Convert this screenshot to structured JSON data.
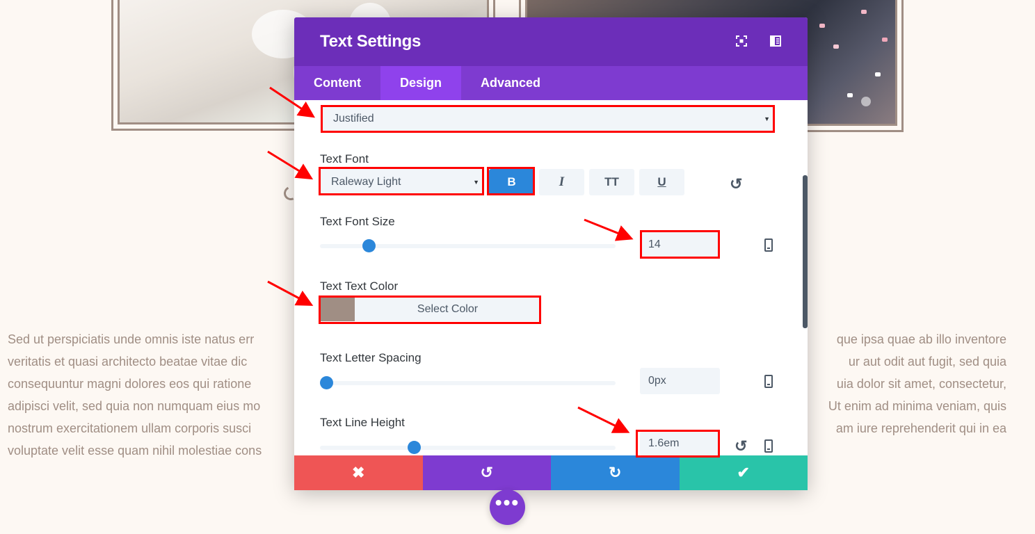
{
  "modal": {
    "title": "Text Settings",
    "header_icons": [
      "fullscreen-icon",
      "sidebar-layout-icon"
    ],
    "tabs": [
      {
        "label": "Content",
        "active": false
      },
      {
        "label": "Design",
        "active": true
      },
      {
        "label": "Advanced",
        "active": false
      }
    ]
  },
  "settings": {
    "text_orientation_value": "Justified",
    "text_font": {
      "label": "Text Font",
      "value": "Raleway Light",
      "bold": "B",
      "italic": "I",
      "uppercase": "TT",
      "underline": "U",
      "bold_active": true
    },
    "font_size": {
      "label": "Text Font Size",
      "value": "14",
      "slider_fraction": 0.15
    },
    "text_color": {
      "label": "Text Text Color",
      "swatch": "#a08e84",
      "button": "Select Color"
    },
    "letter_spacing": {
      "label": "Text Letter Spacing",
      "value": "0px",
      "slider_fraction": 0.0
    },
    "line_height": {
      "label": "Text Line Height",
      "value": "1.6em",
      "slider_fraction": 0.31
    }
  },
  "footer": {
    "icons": [
      "close-icon",
      "undo-icon",
      "redo-icon",
      "check-icon"
    ]
  },
  "colors": {
    "purple": "#6c2eb9",
    "tab_bar": "#7e3bd0",
    "active_tab": "#8f42ec",
    "blue": "#2b87da",
    "red": "#ef5555",
    "green": "#29c4a9",
    "text_brown": "#a08e84",
    "highlight": "#ff0000"
  },
  "background_text": {
    "left": [
      "Sed ut perspiciatis unde omnis iste natus err",
      "veritatis et quasi architecto beatae vitae dic",
      "consequuntur magni dolores eos qui ratione",
      "adipisci velit, sed quia non numquam eius mo",
      "nostrum exercitationem ullam corporis susci",
      "voluptate velit esse quam nihil molestiae cons"
    ],
    "right": [
      "que ipsa quae ab illo inventore",
      "ur aut odit aut fugit, sed quia",
      "uia dolor sit amet, consectetur,",
      "Ut enim ad minima veniam, quis",
      "am iure reprehenderit qui in ea",
      ""
    ]
  }
}
